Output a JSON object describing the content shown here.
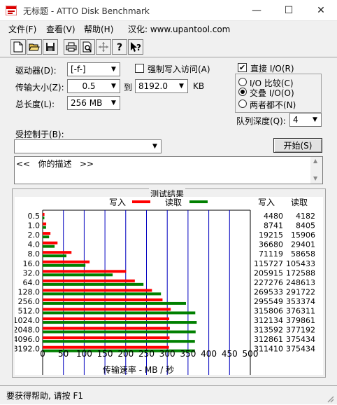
{
  "window": {
    "title": "无标题 - ATTO Disk Benchmark",
    "minimize": "—",
    "maximize": "☐",
    "close": "✕"
  },
  "menu": {
    "file": "文件(F)",
    "view": "查看(V)",
    "help": "帮助(H)",
    "info": "汉化: www.upantool.com"
  },
  "toolbar": {
    "icons": [
      "new-icon",
      "open-icon",
      "save-icon",
      "print-icon",
      "print-preview-icon",
      "move-icon",
      "help-icon",
      "context-help-icon"
    ]
  },
  "settings": {
    "drive_label": "驱动器(D):",
    "drive_value": "[-f-]",
    "force_write_label": "强制写入访问(A)",
    "force_write_checked": false,
    "transfer_size_label": "传输大小(Z):",
    "transfer_from": "0.5",
    "transfer_to_label": "到",
    "transfer_to": "8192.0",
    "transfer_unit": "KB",
    "total_length_label": "总长度(L):",
    "total_length_value": "256 MB",
    "direct_io_label": "直接 I/O(R)",
    "direct_io_checked": true,
    "io_compare_label": "I/O 比较(C)",
    "overlapped_io_label": "交叠 I/O(O)",
    "neither_label": "两者都不(N)",
    "selected_mode": "overlapped",
    "queue_depth_label": "队列深度(Q):",
    "queue_depth_value": "4",
    "controlled_by_label": "受控制于(B):",
    "controlled_by_value": "",
    "start_button": "开始(S)",
    "description": "<<   你的描述   >>"
  },
  "results": {
    "group_title": "测试结果",
    "write_legend": "写入",
    "read_legend": "读取",
    "write_header": "写入",
    "read_header": "读取"
  },
  "chart_data": {
    "type": "bar",
    "orientation": "horizontal",
    "categories": [
      "0.5",
      "1.0",
      "2.0",
      "4.0",
      "8.0",
      "16.0",
      "32.0",
      "64.0",
      "128.0",
      "256.0",
      "512.0",
      "1024.0",
      "2048.0",
      "4096.0",
      "8192.0"
    ],
    "series": [
      {
        "name": "写入",
        "color": "#ff0000",
        "values": [
          4480,
          8741,
          19215,
          36680,
          71119,
          115727,
          205915,
          227276,
          269533,
          295549,
          315806,
          312134,
          313592,
          312861,
          311410
        ]
      },
      {
        "name": "读取",
        "color": "#008000",
        "values": [
          4182,
          8405,
          15906,
          29401,
          58658,
          105433,
          172588,
          248613,
          291722,
          353374,
          376311,
          379861,
          377192,
          375434,
          375434
        ]
      }
    ],
    "xlabel": "传输速率 - MB / 秒",
    "xlim": [
      0,
      500
    ],
    "xticks": [
      0,
      50,
      100,
      150,
      200,
      250,
      300,
      350,
      400,
      450,
      500
    ],
    "grid": true,
    "legend": "top-center"
  },
  "status": {
    "text": "要获得帮助, 请按 F1"
  },
  "colors": {
    "write": "#ff0000",
    "read": "#008000",
    "grid": "#0000c0"
  }
}
